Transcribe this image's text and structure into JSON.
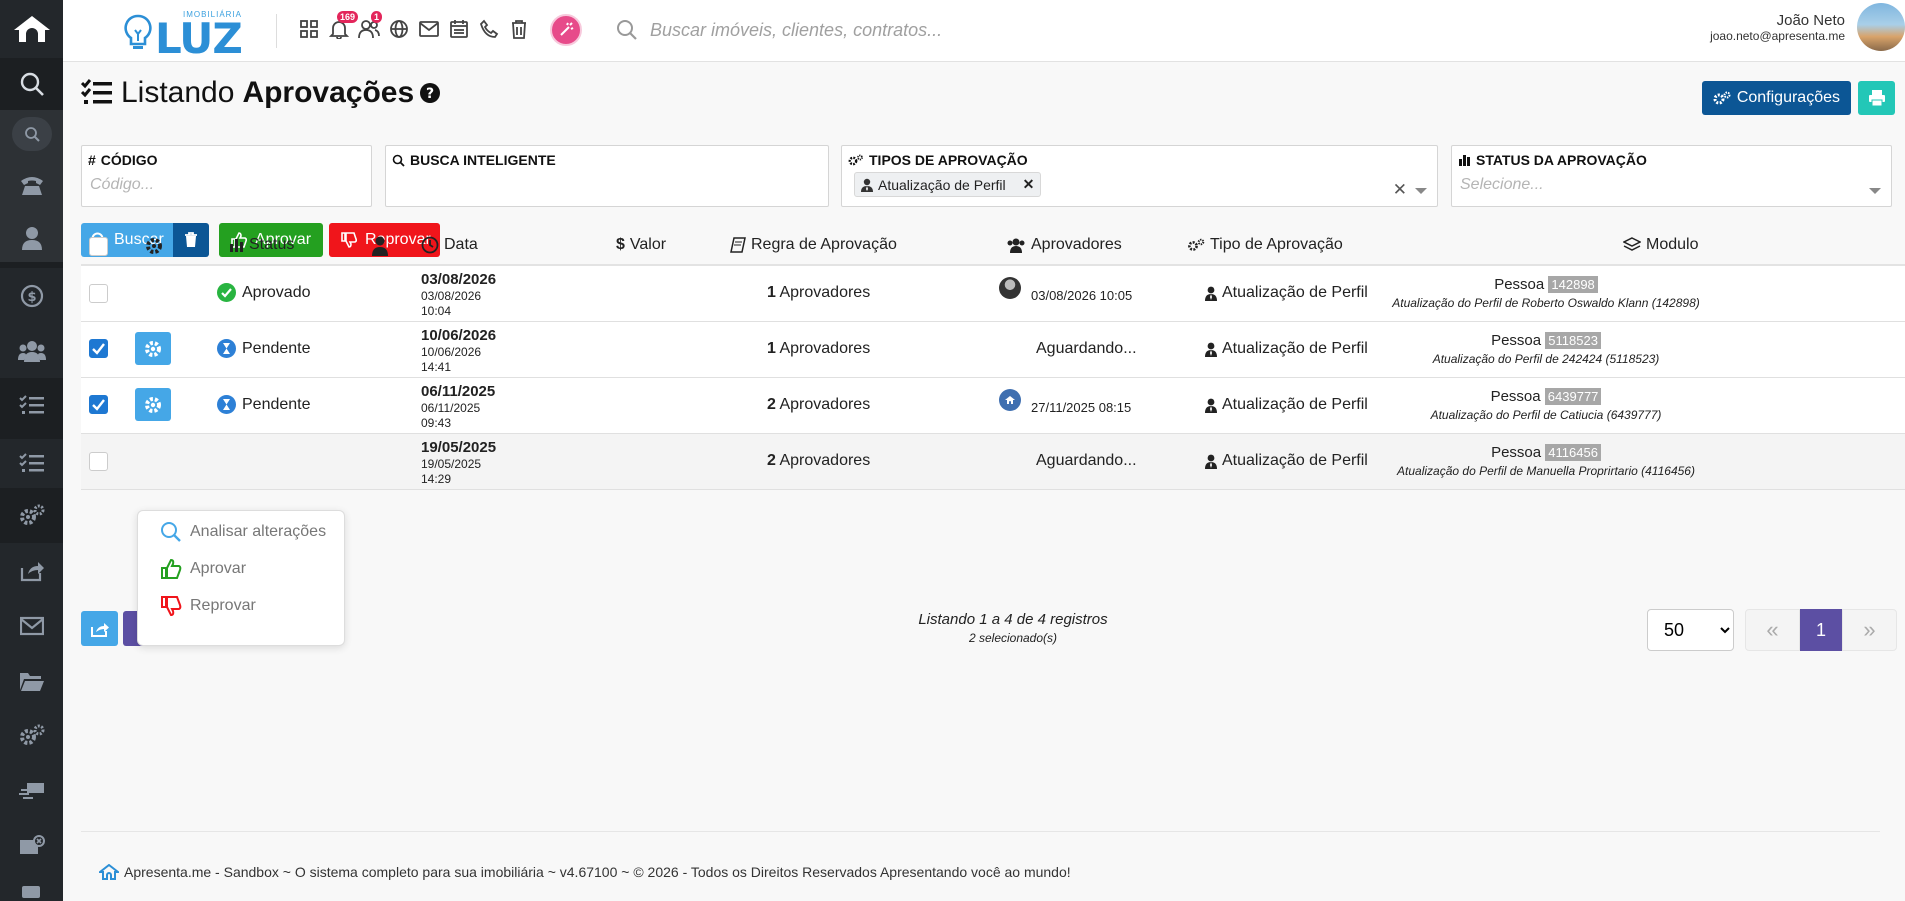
{
  "brand": {
    "small": "IMOBILIÁRIA",
    "big": "LUZ"
  },
  "topbar": {
    "notifications_badge": "169",
    "users_badge": "1",
    "search_placeholder": "Buscar imóveis, clientes, contratos..."
  },
  "user": {
    "name": "João Neto",
    "email": "joao.neto@apresenta.me"
  },
  "page": {
    "title_light": "Listando",
    "title_bold": "Aprovações",
    "config_label": "Configurações"
  },
  "filters": {
    "codigo": {
      "label": "CÓDIGO",
      "placeholder": "Código..."
    },
    "busca": {
      "label": "BUSCA INTELIGENTE",
      "placeholder": ""
    },
    "tipos": {
      "label": "TIPOS DE APROVAÇÃO",
      "chip": "Atualização de Perfil",
      "chip_close": "✕",
      "clear": "✕"
    },
    "status": {
      "label": "STATUS DA APROVAÇÃO",
      "placeholder": "Selecione..."
    }
  },
  "actions": {
    "buscar": "Buscar",
    "aprovar": "Aprovar",
    "reprovar": "Reprovar"
  },
  "table": {
    "headers": {
      "status": "Status",
      "data": "Data",
      "valor": "Valor",
      "regra": "Regra de Aprovação",
      "aprovadores": "Aprovadores",
      "tipo": "Tipo de Aprovação",
      "modulo": "Modulo"
    },
    "rows": [
      {
        "status": "Aprovado",
        "date": "03/08/2026",
        "date2": "03/08/2026",
        "time": "10:04",
        "regra_n": "1",
        "regra_t": "Aprovadores",
        "aprov": "03/08/2026 10:05",
        "tipo": "Atualização de Perfil",
        "modulo": "Pessoa",
        "mod_id": "142898",
        "mod_desc": "Atualização do Perfil de Roberto Oswaldo Klann (142898)"
      },
      {
        "status": "Pendente",
        "date": "10/06/2026",
        "date2": "10/06/2026",
        "time": "14:41",
        "regra_n": "1",
        "regra_t": "Aprovadores",
        "aprov": "Aguardando...",
        "tipo": "Atualização de Perfil",
        "modulo": "Pessoa",
        "mod_id": "5118523",
        "mod_desc": "Atualização do Perfil de 242424 (5118523)"
      },
      {
        "status": "Pendente",
        "date": "06/11/2025",
        "date2": "06/11/2025",
        "time": "09:43",
        "regra_n": "2",
        "regra_t": "Aprovadores",
        "aprov": "27/11/2025 08:15",
        "tipo": "Atualização de Perfil",
        "modulo": "Pessoa",
        "mod_id": "6439777",
        "mod_desc": "Atualização do Perfil de Catiucia (6439777)"
      },
      {
        "status": "",
        "date": "19/05/2025",
        "date2": "19/05/2025",
        "time": "14:29",
        "regra_n": "2",
        "regra_t": "Aprovadores",
        "aprov": "Aguardando...",
        "tipo": "Atualização de Perfil",
        "modulo": "Pessoa",
        "mod_id": "4116456",
        "mod_desc": "Atualização do Perfil de Manuella Proprirtario (4116456)"
      }
    ]
  },
  "dropdown": {
    "analisar": "Analisar alterações",
    "aprovar": "Aprovar",
    "reprovar": "Reprovar"
  },
  "list_info": {
    "listing": "Listando 1 a 4 de 4 registros",
    "selected": "2 selecionado(s)"
  },
  "pagination": {
    "per_page": "50",
    "prev": "«",
    "page": "1",
    "next": "»"
  },
  "footer": {
    "text": "Apresenta.me - Sandbox ~ O sistema completo para sua imobiliária ~ v4.67100 ~ © 2026 - Todos os Direitos Reservados Apresentando você ao mundo!"
  },
  "colors": {
    "sidebar": "#23272b",
    "primary": "#45a7e7",
    "green": "#24a020",
    "red": "#f0151b",
    "navy": "#0c5695",
    "teal": "#23c7b7",
    "purple": "#5c4fa3"
  }
}
